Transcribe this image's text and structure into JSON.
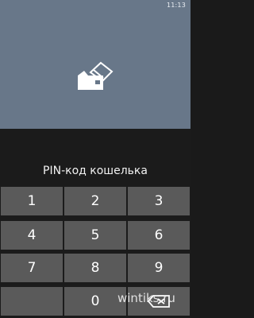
{
  "status_bar": {
    "time": "11:13"
  },
  "header": {
    "icon": "wallet-card-icon"
  },
  "prompt": {
    "title": "PIN-код кошелька"
  },
  "keypad": {
    "keys": [
      "1",
      "2",
      "3",
      "4",
      "5",
      "6",
      "7",
      "8",
      "9",
      "",
      "0",
      "backspace"
    ]
  },
  "watermark": {
    "text": "wintiks.ru"
  },
  "colors": {
    "top_background": "#687789",
    "panel_background": "#1b1b1b",
    "key_background": "#5a5a5a",
    "text": "#ffffff"
  }
}
